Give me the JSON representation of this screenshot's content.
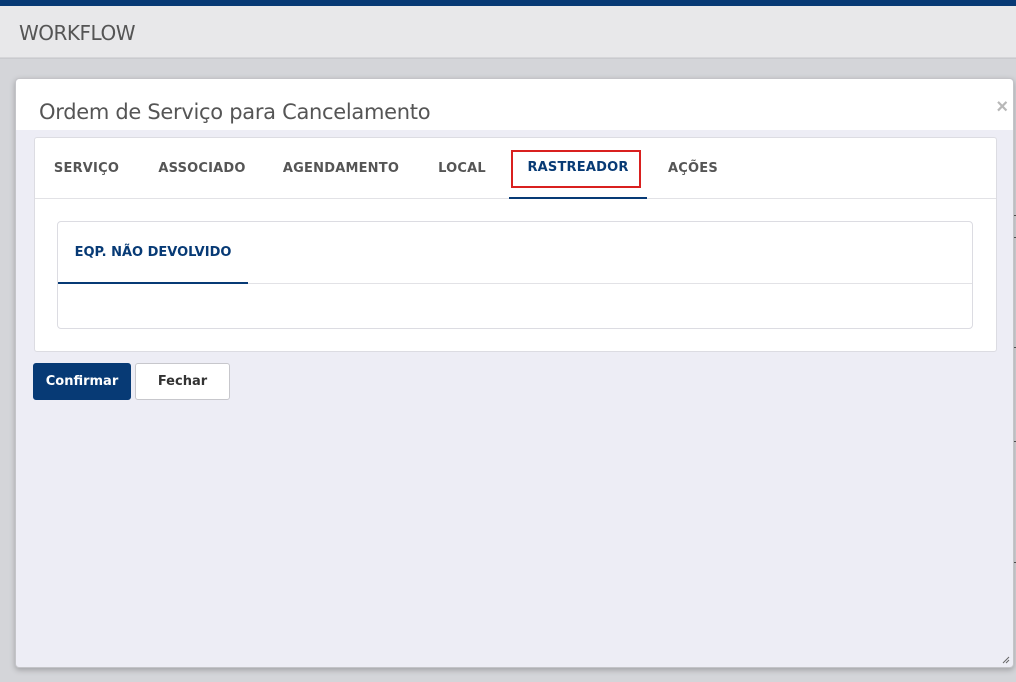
{
  "header": {
    "title": "WORKFLOW"
  },
  "modal": {
    "title": "Ordem de Serviço para Cancelamento",
    "close_label": "×",
    "tabs": [
      {
        "label": "SERVIÇO",
        "active": false
      },
      {
        "label": "ASSOCIADO",
        "active": false
      },
      {
        "label": "AGENDAMENTO",
        "active": false
      },
      {
        "label": "LOCAL",
        "active": false
      },
      {
        "label": "RASTREADOR",
        "active": true
      },
      {
        "label": "AÇÕES",
        "active": false
      }
    ],
    "subtabs": [
      {
        "label": "EQP. NÃO DEVOLVIDO",
        "active": true
      }
    ],
    "buttons": {
      "confirm_label": "Confirmar",
      "close_label": "Fechar"
    }
  },
  "colors": {
    "brand": "#073a75",
    "highlight": "#d9201f"
  }
}
